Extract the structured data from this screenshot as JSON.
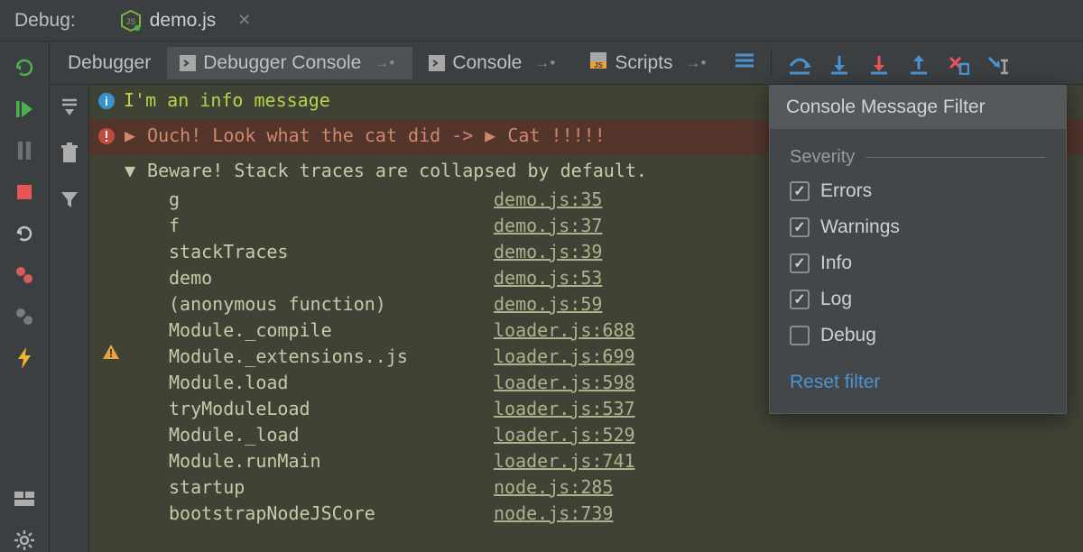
{
  "topbar": {
    "label": "Debug:",
    "filename": "demo.js"
  },
  "tabs": {
    "debugger": "Debugger",
    "debugger_console": "Debugger Console",
    "console": "Console",
    "scripts": "Scripts"
  },
  "console": {
    "info_msg": "I'm an info message",
    "error_msg_a": "Ouch! Look what the cat did ->",
    "error_msg_b": "Cat !!!!!",
    "warn_msg": "Beware! Stack traces are collapsed by default.",
    "stack": [
      {
        "fn": "g",
        "loc": "demo.js:35"
      },
      {
        "fn": "f",
        "loc": "demo.js:37"
      },
      {
        "fn": "stackTraces",
        "loc": "demo.js:39"
      },
      {
        "fn": "demo",
        "loc": "demo.js:53"
      },
      {
        "fn": "(anonymous function)",
        "loc": "demo.js:59"
      },
      {
        "fn": "Module._compile",
        "loc": "loader.js:688"
      },
      {
        "fn": "Module._extensions..js",
        "loc": "loader.js:699"
      },
      {
        "fn": "Module.load",
        "loc": "loader.js:598"
      },
      {
        "fn": "tryModuleLoad",
        "loc": "loader.js:537"
      },
      {
        "fn": "Module._load",
        "loc": "loader.js:529"
      },
      {
        "fn": "Module.runMain",
        "loc": "loader.js:741"
      },
      {
        "fn": "startup",
        "loc": "node.js:285"
      },
      {
        "fn": "bootstrapNodeJSCore",
        "loc": "node.js:739"
      }
    ]
  },
  "filter": {
    "title": "Console Message Filter",
    "severity_label": "Severity",
    "options": [
      {
        "label": "Errors",
        "checked": true
      },
      {
        "label": "Warnings",
        "checked": true
      },
      {
        "label": "Info",
        "checked": true
      },
      {
        "label": "Log",
        "checked": true
      },
      {
        "label": "Debug",
        "checked": false
      }
    ],
    "reset": "Reset filter"
  }
}
